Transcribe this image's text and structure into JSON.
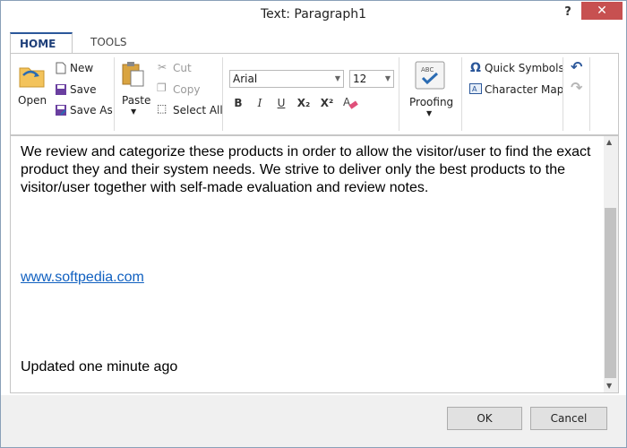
{
  "window": {
    "title": "Text:  Paragraph1",
    "help": "?",
    "close": "✕"
  },
  "tabs": [
    {
      "label": "HOME"
    },
    {
      "label": "TOOLS"
    }
  ],
  "ribbon": {
    "open": "Open",
    "new": "New",
    "save": "Save",
    "save_as": "Save As",
    "paste": "Paste",
    "cut": "Cut",
    "copy": "Copy",
    "select_all": "Select All",
    "font": "Arial",
    "size": "12",
    "bold": "B",
    "italic": "I",
    "underline": "U",
    "subscript": "X₂",
    "superscript": "X²",
    "proofing": "Proofing",
    "quick_symbols": "Quick Symbols",
    "character_map": "Character Map"
  },
  "editor": {
    "paragraph": "We review and categorize these products in order to allow the visitor/user to find the exact product they and their system needs. We strive to deliver only the best products to the visitor/user together with self-made evaluation and review notes.",
    "link": "www.softpedia.com",
    "updated": "Updated one minute ago"
  },
  "footer": {
    "ok": "OK",
    "cancel": "Cancel"
  }
}
